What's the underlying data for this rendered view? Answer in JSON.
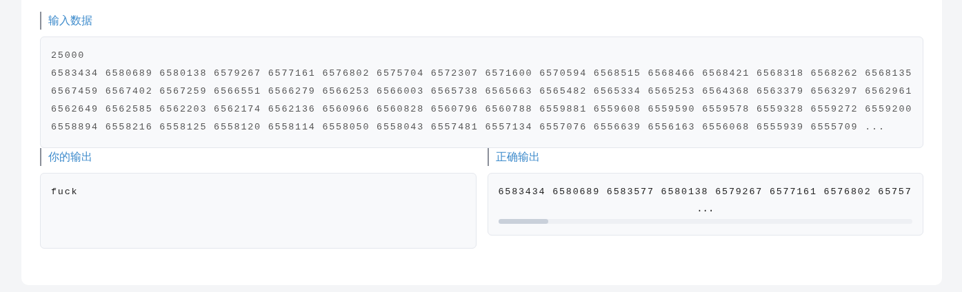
{
  "input_section": {
    "title": "输入数据",
    "lines": [
      "25000",
      "6583434 6580689 6580138 6579267 6577161 6576802 6575704 6572307 6571600 6570594 6568515 6568466 6568421 6568318 6568262 6568135",
      "6567459 6567402 6567259 6566551 6566279 6566253 6566003 6565738 6565663 6565482 6565334 6565253 6564368 6563379 6563297 6562961",
      "6562649 6562585 6562203 6562174 6562136 6560966 6560828 6560796 6560788 6559881 6559608 6559590 6559578 6559328 6559272 6559200",
      "6558894 6558216 6558125 6558120 6558114 6558050 6558043 6557481 6557134 6557076 6556639 6556163 6556068 6555939 6555709 ..."
    ]
  },
  "your_output": {
    "title": "你的输出",
    "text": "fuck"
  },
  "correct_output": {
    "title": "正确输出",
    "text": "6583434 6580689 6583577 6580138 6579267 6577161 6576802 65757",
    "more": "..."
  }
}
